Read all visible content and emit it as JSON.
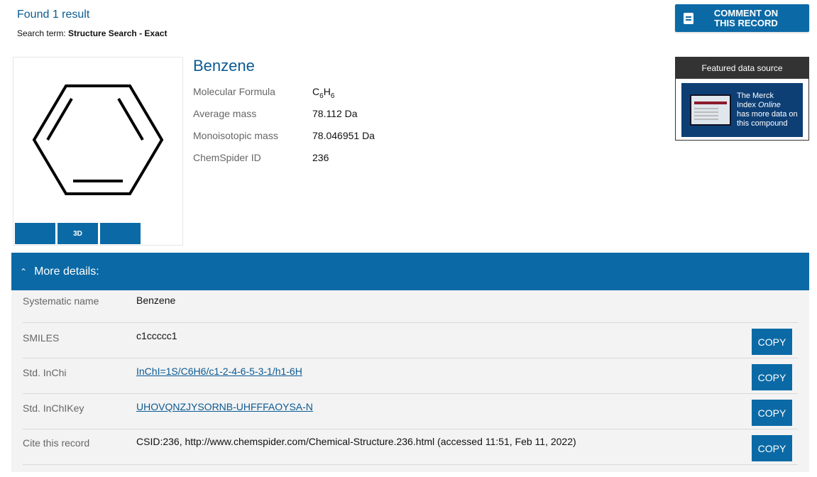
{
  "search": {
    "result_count": "Found 1 result",
    "term_label": "Search term:",
    "term_value": "Structure Search - Exact"
  },
  "comment_button": {
    "line1": "COMMENT ON",
    "line2": "THIS RECORD",
    "icon": "comment-icon"
  },
  "structure": {
    "tools": [
      {
        "icon": "save-icon"
      },
      {
        "label": "3D"
      },
      {
        "icon": "zoom-in-icon"
      }
    ]
  },
  "compound": {
    "name": "Benzene",
    "formula": {
      "label": "Molecular Formula",
      "c": "C",
      "c_count": "6",
      "h": "H",
      "h_count": "6"
    },
    "average_mass": {
      "label": "Average mass",
      "value": "78.112 Da"
    },
    "monoisotopic_mass": {
      "label": "Monoisotopic mass",
      "value": "78.046951 Da"
    },
    "chemspider_id": {
      "label": "ChemSpider ID",
      "value": "236"
    }
  },
  "featured": {
    "heading": "Featured data source",
    "merck_line1": "The Merck",
    "merck_line2": "Index",
    "merck_line2_italic": "Online",
    "merck_line3": "has more data on",
    "merck_line4": "this compound"
  },
  "details": {
    "title": "More details:",
    "copy_label": "COPY",
    "rows": [
      {
        "label": "Systematic name",
        "value": "Benzene"
      },
      {
        "label": "SMILES",
        "value": "c1ccccc1"
      },
      {
        "label": "Std. InChi",
        "value": "InChI=1S/C6H6/c1-2-4-6-5-3-1/h1-6H"
      },
      {
        "label": "Std. InChIKey",
        "value": "UHOVQNZJYSORNB-UHFFFAOYSA-N"
      },
      {
        "label": "Cite this record",
        "value": "CSID:236, http://www.chemspider.com/Chemical-Structure.236.html (accessed 11:51, Feb 11, 2022)"
      }
    ]
  },
  "colors": {
    "accent": "#0b6aa6",
    "link": "#0a5a92",
    "panel": "#f3f3f3"
  }
}
